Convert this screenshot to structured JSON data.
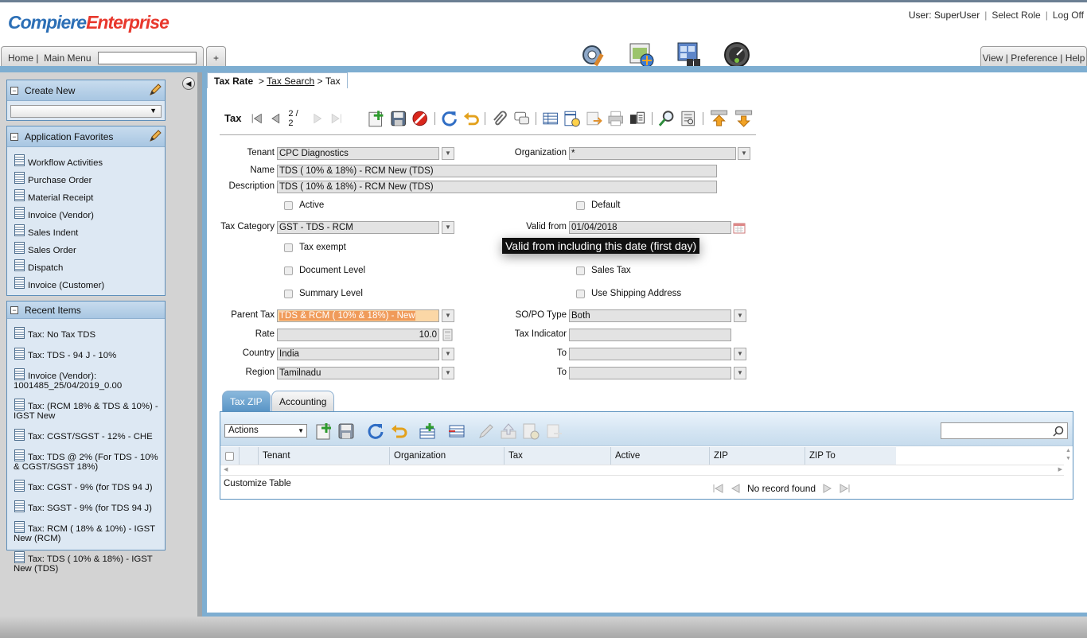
{
  "header": {
    "logo_part1": "Compiere",
    "logo_part2": "Enterprise",
    "user_label": "User: SuperUser",
    "select_role": "Select Role",
    "log_off": "Log Off",
    "home": "Home",
    "main_menu": "Main Menu",
    "add_tab": "+",
    "view": "View",
    "preference": "Preference",
    "help": "Help",
    "icons": [
      "performance-icon",
      "workspace-icon",
      "window-search-icon",
      "dashboard-gauge-icon"
    ]
  },
  "sidebar": {
    "create_new": {
      "title": "Create New"
    },
    "favorites": {
      "title": "Application Favorites",
      "items": [
        "Workflow Activities",
        "Purchase Order",
        "Material Receipt",
        "Invoice (Vendor)",
        "Sales Indent",
        "Sales Order",
        "Dispatch",
        "Invoice (Customer)"
      ]
    },
    "recent": {
      "title": "Recent Items",
      "items": [
        "Tax: No Tax TDS",
        "Tax: TDS - 94 J - 10%",
        "Invoice (Vendor): 1001485_25/04/2019_0.00",
        "Tax: (RCM 18% & TDS & 10%) - IGST New",
        "Tax: CGST/SGST - 12% - CHE",
        "Tax: TDS @ 2% (For TDS - 10% & CGST/SGST 18%)",
        "Tax: CGST - 9% (for TDS 94 J)",
        "Tax: SGST - 9% (for TDS 94 J)",
        "Tax: RCM ( 18% & 10%) - IGST New (RCM)",
        "Tax: TDS ( 10% & 18%) - IGST New (TDS)"
      ]
    }
  },
  "breadcrumb": {
    "current": "Tax Rate",
    "sep1": ">",
    "link": "Tax Search",
    "sep2": ">",
    "last": "Tax"
  },
  "toolbar": {
    "title": "Tax",
    "record_pos": "2 / 2"
  },
  "form": {
    "tenant_label": "Tenant",
    "tenant_value": "CPC Diagnostics",
    "org_label": "Organization",
    "org_value": "*",
    "name_label": "Name",
    "name_value": "TDS ( 10% & 18%) - RCM New (TDS)",
    "description_label": "Description",
    "description_value": "TDS ( 10% & 18%) - RCM New (TDS)",
    "active_label": "Active",
    "default_label": "Default",
    "tax_category_label": "Tax Category",
    "tax_category_value": "GST - TDS - RCM",
    "valid_from_label": "Valid from",
    "valid_from_value": "01/04/2018",
    "tax_exempt_label": "Tax exempt",
    "document_level_label": "Document Level",
    "sales_tax_label": "Sales Tax",
    "summary_level_label": "Summary Level",
    "use_shipping_label": "Use Shipping Address",
    "parent_tax_label": "Parent Tax",
    "parent_tax_value": "TDS & RCM ( 10% & 18%) -  New",
    "sopo_label": "SO/PO Type",
    "sopo_value": "Both",
    "rate_label": "Rate",
    "rate_value": "10.0",
    "tax_indicator_label": "Tax Indicator",
    "tax_indicator_value": "",
    "country_label": "Country",
    "country_value": "India",
    "to_label": "To",
    "to_country_value": "",
    "region_label": "Region",
    "region_value": "Tamilnadu",
    "to_region_value": ""
  },
  "tooltip": "Valid from including this date (first day)",
  "subtabs": [
    "Tax ZIP",
    "Accounting"
  ],
  "subgrid": {
    "actions_label": "Actions",
    "columns": [
      "Tenant",
      "Organization",
      "Tax",
      "Active",
      "ZIP",
      "ZIP To"
    ],
    "customize_label": "Customize Table",
    "status": "No record found"
  }
}
